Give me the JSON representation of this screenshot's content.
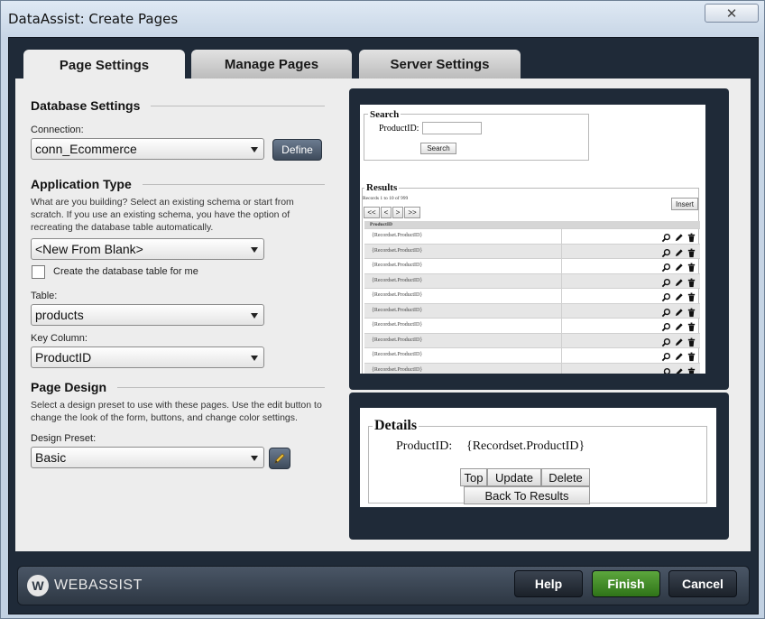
{
  "window": {
    "title": "DataAssist: Create Pages",
    "close_glyph": "✕"
  },
  "tabs": [
    {
      "label": "Page Settings",
      "active": true
    },
    {
      "label": "Manage Pages",
      "active": false
    },
    {
      "label": "Server Settings",
      "active": false
    }
  ],
  "database": {
    "heading": "Database Settings",
    "connection_label": "Connection:",
    "connection_value": "conn_Ecommerce",
    "define_label": "Define"
  },
  "application": {
    "heading": "Application Type",
    "description": "What are you building? Select an existing schema or start from scratch. If you use an existing schema, you have the option of recreating the database table automatically.",
    "type_value": "<New From Blank>",
    "create_table_label": "Create the database table for me",
    "create_table_checked": false,
    "table_label": "Table:",
    "table_value": "products",
    "key_label": "Key Column:",
    "key_value": "ProductID"
  },
  "page_design": {
    "heading": "Page Design",
    "description": "Select a design preset to use with these pages. Use the edit button to change the look of the form, buttons, and change color settings.",
    "preset_label": "Design Preset:",
    "preset_value": "Basic",
    "edit_icon": "pencil-icon"
  },
  "preview_results": {
    "search_legend": "Search",
    "search_field_label": "ProductID:",
    "search_button": "Search",
    "results_legend": "Results",
    "records_text": "Records 1 to 10 of 999",
    "insert_button": "Insert",
    "pager": [
      "<<",
      "<",
      ">",
      ">>"
    ],
    "column_header": "ProductID",
    "rows": [
      "{Recordset.ProductID}",
      "{Recordset.ProductID}",
      "{Recordset.ProductID}",
      "{Recordset.ProductID}",
      "{Recordset.ProductID}",
      "{Recordset.ProductID}",
      "{Recordset.ProductID}",
      "{Recordset.ProductID}",
      "{Recordset.ProductID}",
      "{Recordset.ProductID}"
    ],
    "row_icons": [
      "magnifier-icon",
      "pencil-icon",
      "trash-icon"
    ]
  },
  "preview_details": {
    "legend": "Details",
    "field_label": "ProductID:",
    "field_value": "{Recordset.ProductID}",
    "buttons": {
      "top": "Top",
      "update": "Update",
      "delete": "Delete",
      "back": "Back To Results"
    }
  },
  "footer": {
    "logo_mark": "W",
    "logo_text": "WEBASSIST",
    "help_label": "Help",
    "finish_label": "Finish",
    "cancel_label": "Cancel",
    "finish_color": "#4a9a2e"
  }
}
